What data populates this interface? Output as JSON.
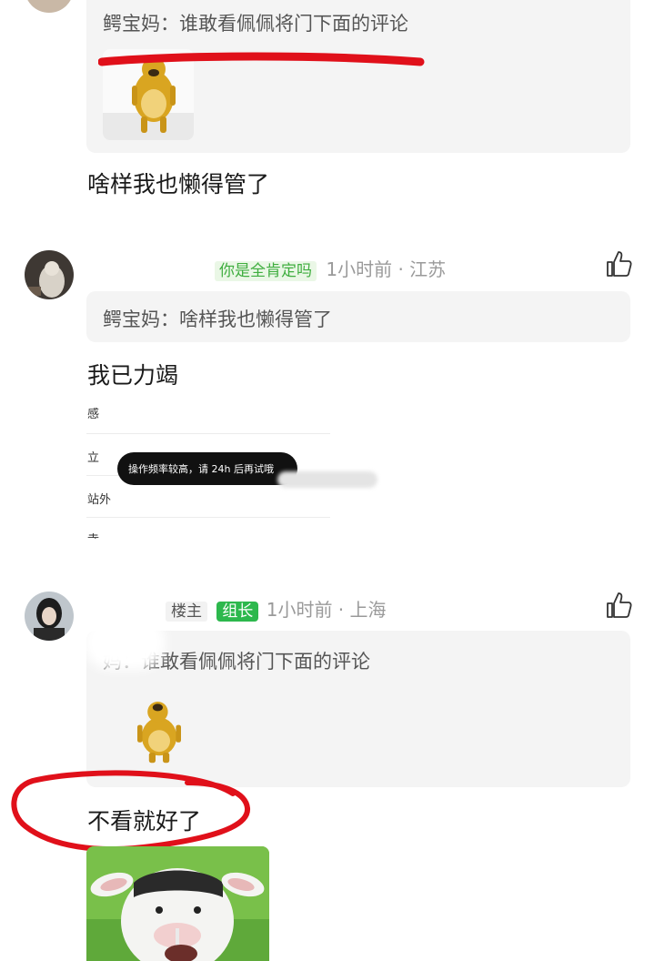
{
  "comments": [
    {
      "quote": {
        "author": "鳄宝妈",
        "text": "谁敢看佩佩将门下面的评论"
      },
      "reply": "啥样我也懒得管了",
      "sticker": "bear-sticker"
    },
    {
      "username": "你是全肯定吗",
      "time_location": "1小时前 · 江苏",
      "quote": {
        "author": "鳄宝妈",
        "text": "啥样我也懒得管了"
      },
      "reply": "我已力竭"
    },
    {
      "badge_op": "楼主",
      "badge_role": "组长",
      "time_location": "1小时前 · 上海",
      "quote": {
        "author": "妈",
        "text": "谁敢看佩佩将门下面的评论"
      },
      "reply": "不看就好了",
      "sticker": "bear-sticker",
      "reply_sticker": "cow-sticker"
    }
  ],
  "overlay": {
    "side_items": [
      "感",
      "立",
      "站外",
      "寺"
    ],
    "toast": "操作频率较高，请 24h 后再试哦"
  },
  "colors": {
    "username_green": "#3fae3f",
    "username_bg": "#eaf7e6",
    "badge_green": "#2db84d",
    "annotation_red": "#e0101a"
  }
}
